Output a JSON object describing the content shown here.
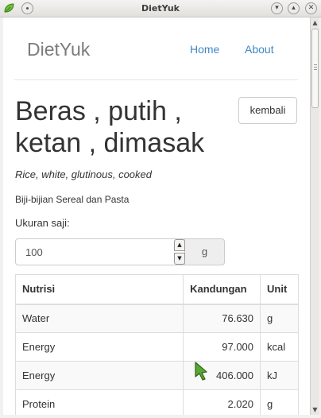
{
  "window": {
    "title": "DietYuk"
  },
  "navbar": {
    "brand": "DietYuk",
    "home": "Home",
    "about": "About"
  },
  "food": {
    "title": "Beras , putih , ketan , dimasak",
    "english_name": "Rice, white, glutinous, cooked",
    "category": "Biji-bijian Sereal dan Pasta",
    "back_label": "kembali"
  },
  "serving": {
    "label": "Ukuran saji:",
    "value": "100",
    "unit": "g"
  },
  "table": {
    "headers": [
      "Nutrisi",
      "Kandungan",
      "Unit"
    ],
    "rows": [
      {
        "name": "Water",
        "amount": "76.630",
        "unit": "g"
      },
      {
        "name": "Energy",
        "amount": "97.000",
        "unit": "kcal"
      },
      {
        "name": "Energy",
        "amount": "406.000",
        "unit": "kJ"
      },
      {
        "name": "Protein",
        "amount": "2.020",
        "unit": "g"
      }
    ]
  },
  "icons": {
    "app": "leaf-app-icon",
    "window_menu": "window-menu-icon",
    "minimize": "chevron-down-icon",
    "maximize": "chevron-up-icon",
    "close": "close-icon",
    "cursor": "mouse-pointer-icon"
  },
  "colors": {
    "link": "#3f88c5",
    "brand": "#7b7b7b",
    "text": "#333333",
    "stripe": "#f9f9f9"
  }
}
